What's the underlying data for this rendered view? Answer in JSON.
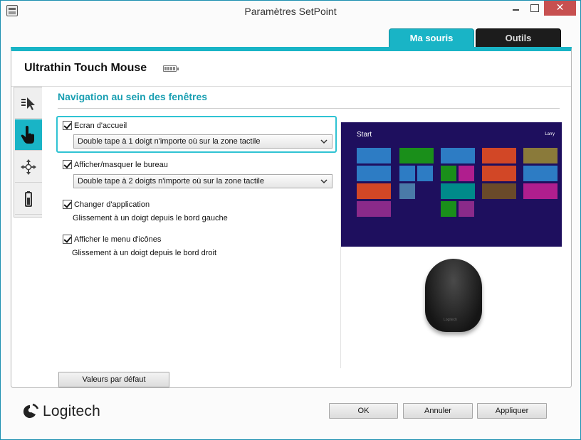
{
  "window": {
    "title": "Paramètres SetPoint",
    "close_glyph": "✕"
  },
  "tabs": [
    {
      "label": "Ma souris",
      "active": true
    },
    {
      "label": "Outils",
      "active": false
    }
  ],
  "device": {
    "name": "Ultrathin Touch Mouse"
  },
  "side_tabs": [
    {
      "icon": "pointer-settings-icon",
      "active": false
    },
    {
      "icon": "touch-hand-icon",
      "active": true
    },
    {
      "icon": "move-arrows-icon",
      "active": false
    },
    {
      "icon": "battery-icon",
      "active": false
    }
  ],
  "section": {
    "title": "Navigation au sein des fenêtres"
  },
  "options": [
    {
      "label": "Ecran d'accueil",
      "checked": true,
      "type": "select",
      "value": "Double tape à 1 doigt n'importe où sur la zone tactile"
    },
    {
      "label": "Afficher/masquer le bureau",
      "checked": true,
      "type": "select",
      "value": "Double tape à 2 doigts n'importe où sur la zone tactile"
    },
    {
      "label": "Changer d'application",
      "checked": true,
      "type": "text",
      "value": "Glissement à un doigt depuis le bord gauche"
    },
    {
      "label": "Afficher le menu d'icônes",
      "checked": true,
      "type": "text",
      "value": "Glissement à un doigt depuis le bord droit"
    }
  ],
  "preview": {
    "start_label": "Start",
    "user_label": "Larry",
    "mouse_brand": "Logitech"
  },
  "buttons": {
    "defaults": "Valeurs par défaut",
    "ok": "OK",
    "cancel": "Annuler",
    "apply": "Appliquer"
  },
  "brand": {
    "logo_text": "Logitech"
  },
  "colors": {
    "accent": "#19b4c6",
    "dark_tab": "#1c1c1c",
    "start_bg": "#1e0f5e"
  }
}
